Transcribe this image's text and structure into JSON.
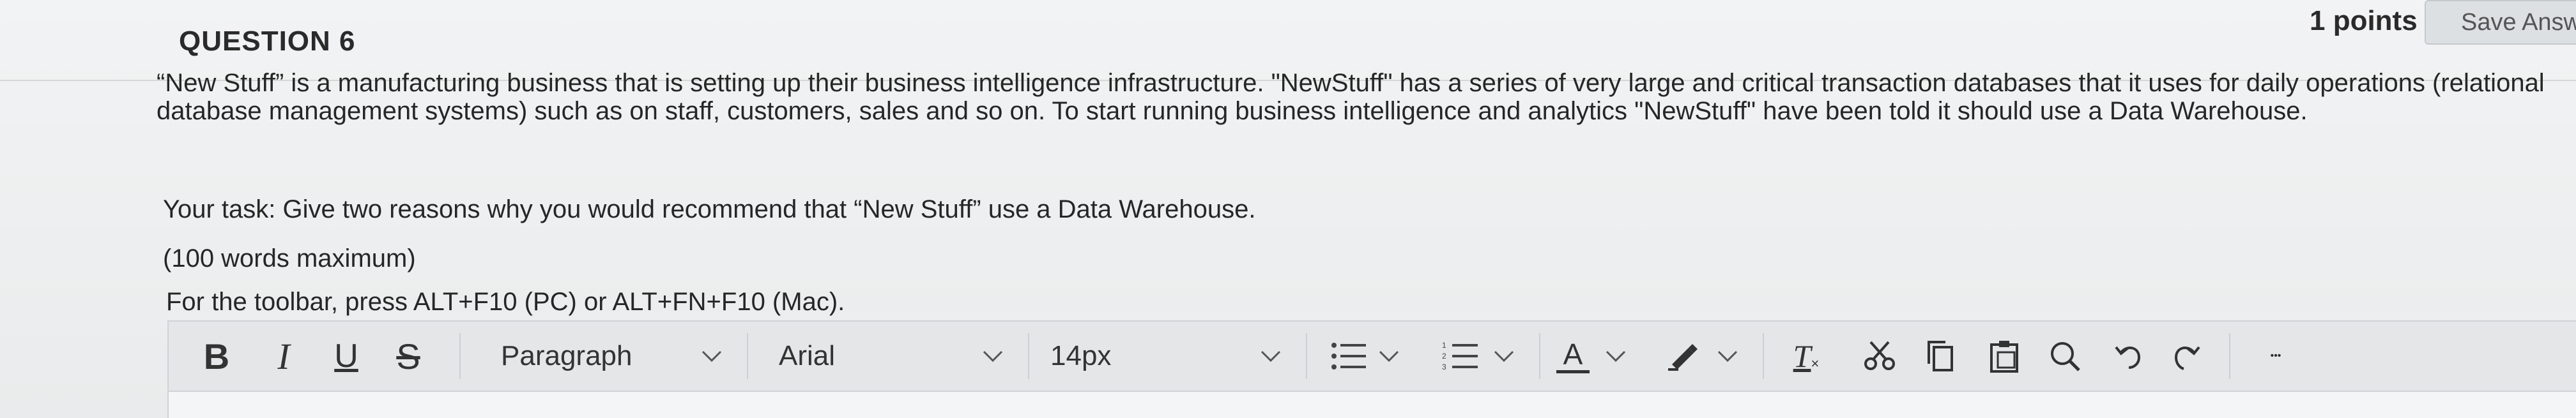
{
  "question": {
    "title": "QUESTION 6",
    "points": "1 points",
    "save_label": "Save Answ"
  },
  "body": {
    "paragraph1": "“New Stuff” is a manufacturing business that is setting up their business intelligence infrastructure. \"NewStuff\" has a series of very large and critical transaction databases that it uses for daily operations (relational database management systems) such as on staff, customers, sales and so on. To start running business intelligence and analytics \"NewStuff\" have been told it should use a Data Warehouse.",
    "task": "Your task: Give two reasons why you would recommend that “New Stuff” use a Data Warehouse.",
    "limit": "(100 words maximum)",
    "toolbar_hint": "For the toolbar, press ALT+F10 (PC) or ALT+FN+F10 (Mac)."
  },
  "toolbar": {
    "bold": "B",
    "italic": "I",
    "underline": "U",
    "strike": "S",
    "block_format": "Paragraph",
    "font_family": "Arial",
    "font_size": "14px",
    "text_color_letter": "A",
    "clear_format_letter": "T",
    "more": "•••"
  }
}
